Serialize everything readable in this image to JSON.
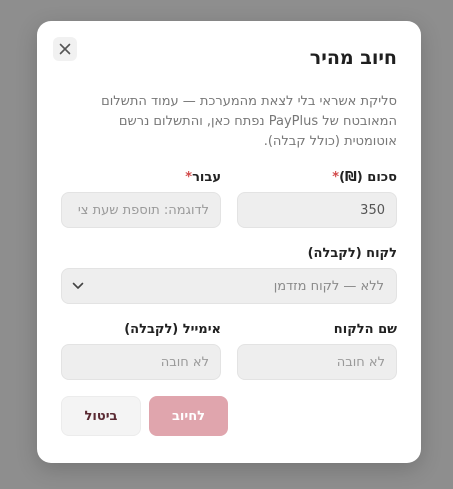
{
  "dialog": {
    "title": "חיוב מהיר",
    "description": "סליקת אשראי בלי לצאת מהמערכת — עמוד התשלום המאובטח של PayPlus נפתח כאן, והתשלום נרשם אוטומטית (כולל קבלה).",
    "close_icon": "close-icon"
  },
  "form": {
    "amount": {
      "label": "סכום (₪)",
      "required_mark": "*",
      "value": "350"
    },
    "for": {
      "label": "עבור",
      "required_mark": "*",
      "placeholder": "לדוגמה: תוספת שעת צי"
    },
    "customer": {
      "label": "לקוח (לקבלה)",
      "selected": "ללא — לקוח מזדמן"
    },
    "customer_name": {
      "label": "שם הלקוח",
      "placeholder": "לא חובה"
    },
    "email": {
      "label": "אימייל (לקבלה)",
      "placeholder": "לא חובה"
    }
  },
  "actions": {
    "charge_label": "לחיוב",
    "cancel_label": "ביטול"
  },
  "colors": {
    "accent": "#e0a5ad",
    "required": "#d24a4a",
    "backdrop": "#8e8e8e"
  }
}
